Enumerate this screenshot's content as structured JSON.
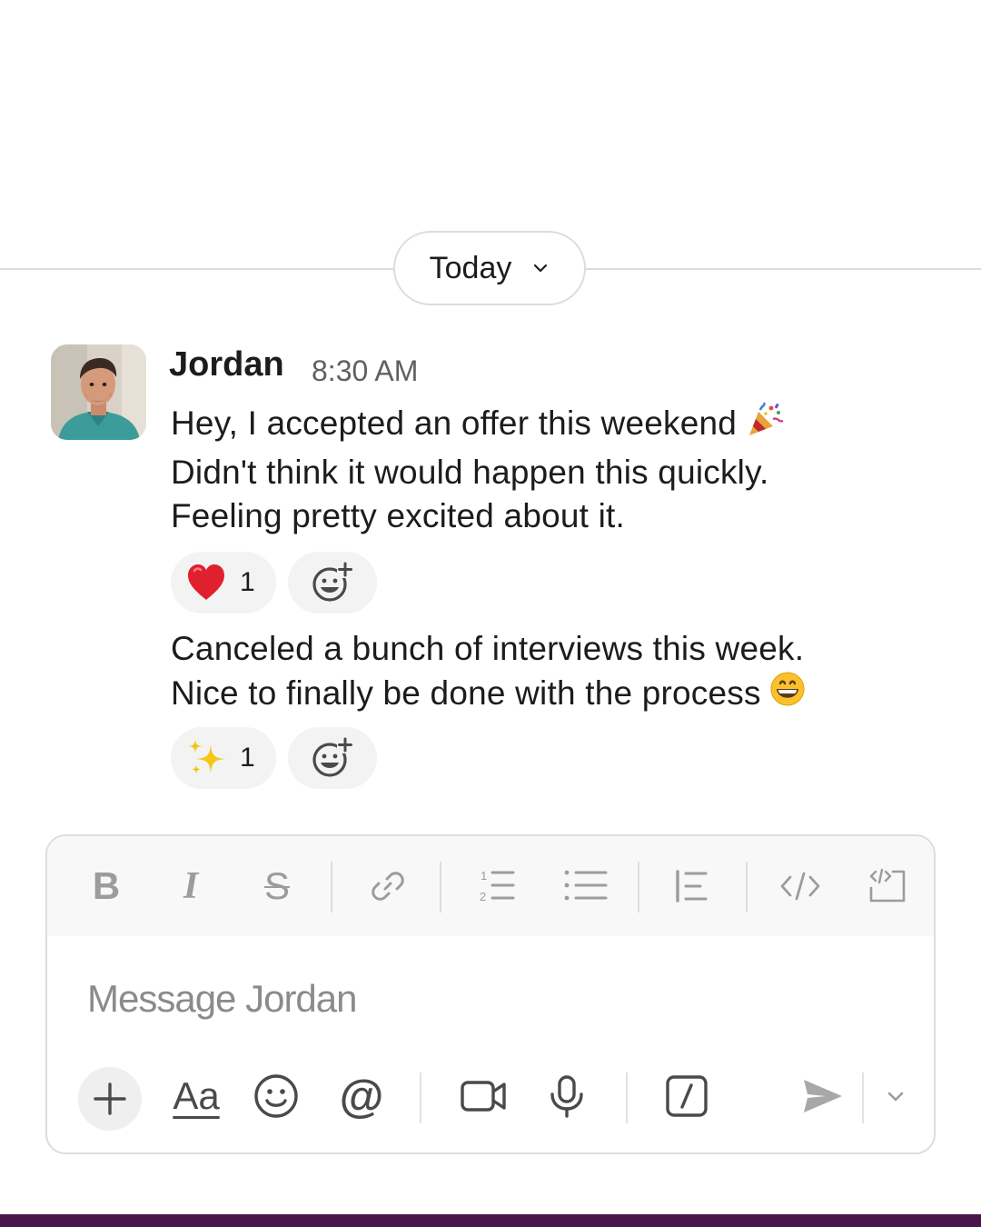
{
  "date_divider": {
    "label": "Today"
  },
  "message": {
    "sender": "Jordan",
    "time": "8:30 AM",
    "block1": {
      "lines": [
        "Hey, I accepted an offer this weekend",
        "Didn't think it would happen this quickly.",
        "Feeling pretty excited about it."
      ],
      "trailing_emoji": "party-popper"
    },
    "reactions1": [
      {
        "emoji": "red-heart",
        "count": "1"
      }
    ],
    "block2": {
      "lines": [
        "Canceled a bunch of interviews this week.",
        "Nice to finally be done with the process"
      ],
      "trailing_emoji": "grinning-face"
    },
    "reactions2": [
      {
        "emoji": "sparkles",
        "count": "1"
      }
    ]
  },
  "composer": {
    "placeholder": "Message Jordan",
    "toolbar": {
      "bold": "B",
      "italic": "I",
      "strike": "S"
    },
    "format_label": "Aa",
    "mention_label": "@"
  },
  "colors": {
    "brand_bar": "#4a154b",
    "heart": "#e0202e",
    "text": "#1d1c1d",
    "muted": "#616061"
  }
}
